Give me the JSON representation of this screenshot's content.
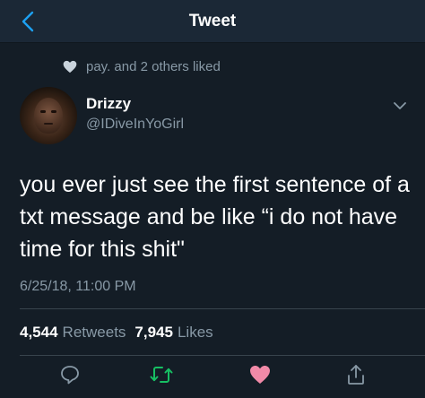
{
  "header": {
    "title": "Tweet"
  },
  "social_context": {
    "text": "pay. and 2 others liked"
  },
  "author": {
    "display_name": "Drizzy",
    "handle": "@IDiveInYoGirl"
  },
  "tweet": {
    "text": "you ever just see the first sentence of a txt message and be like “i do not have time for this shit\"",
    "timestamp": "6/25/18, 11:00 PM"
  },
  "stats": {
    "retweets_count": "4,544",
    "retweets_label": "Retweets",
    "likes_count": "7,945",
    "likes_label": "Likes"
  },
  "actions": {
    "reply_icon": "reply-icon",
    "retweet_icon": "retweet-icon",
    "like_icon": "heart-icon",
    "share_icon": "share-icon",
    "liked": true
  },
  "colors": {
    "background": "#141d26",
    "header_background": "#1b2836",
    "accent": "#1da1f2",
    "secondary_text": "#8899a6",
    "retweet_green": "#17bf63",
    "like_pink": "#e0245e",
    "divider": "#38444d"
  }
}
